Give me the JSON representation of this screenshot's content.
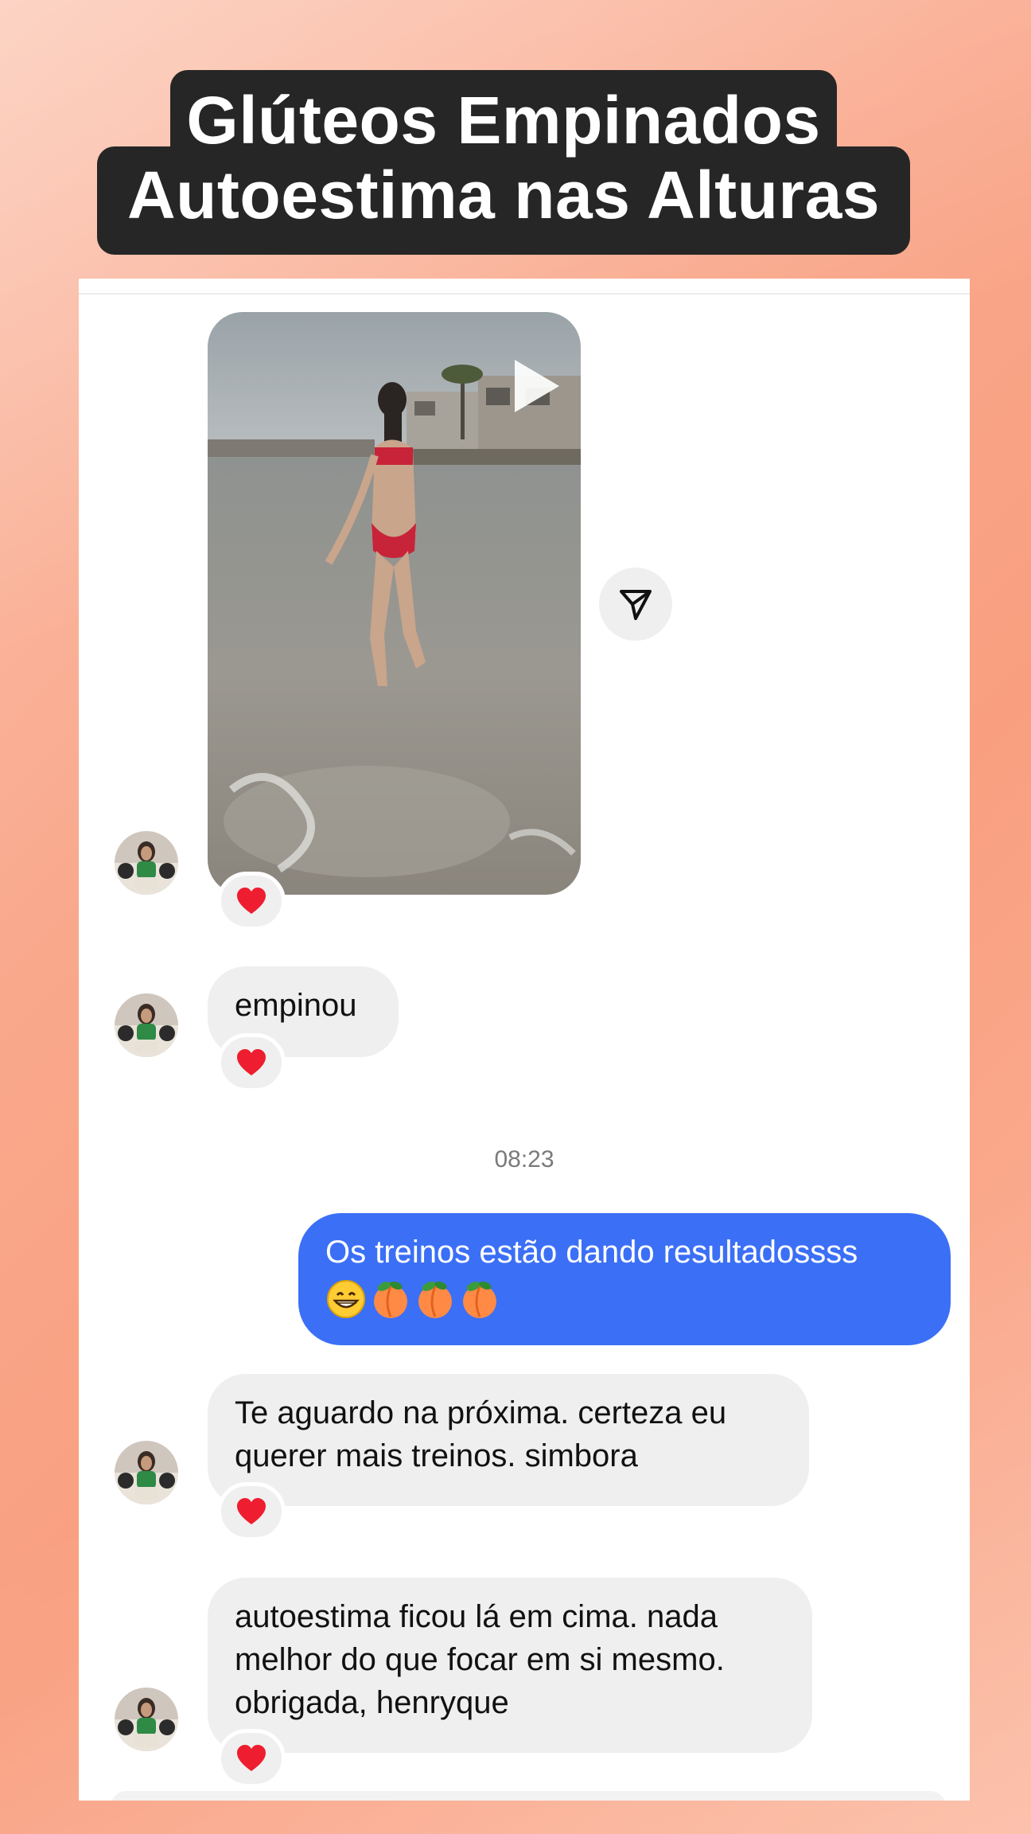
{
  "title": {
    "line1": "Glúteos Empinados",
    "line2": "Autoestima nas Alturas"
  },
  "chat": {
    "messages": [
      {
        "type": "video",
        "from": "received",
        "reaction": "heart-icon"
      },
      {
        "type": "text",
        "from": "received",
        "text": "empinou",
        "reaction": "heart-icon"
      },
      {
        "type": "timestamp",
        "text": "08:23"
      },
      {
        "type": "text",
        "from": "sent",
        "text": "Os treinos estão dando resultadossss",
        "emojis": [
          "grin-emoji",
          "peach-emoji",
          "peach-emoji",
          "peach-emoji"
        ]
      },
      {
        "type": "text",
        "from": "received",
        "text_lines": [
          "Te aguardo na próxima. certeza eu",
          "querer mais treinos. simbora"
        ],
        "reaction": "heart-icon"
      },
      {
        "type": "text",
        "from": "received",
        "text_lines": [
          "autoestima ficou lá em cima. nada",
          "melhor do que focar em si mesmo.",
          "obrigada, henryque"
        ],
        "reaction": "heart-icon"
      }
    ]
  },
  "colors": {
    "sent_bubble": "#3b6ff6",
    "received_bubble": "#efefef",
    "title_pill": "#262626"
  }
}
